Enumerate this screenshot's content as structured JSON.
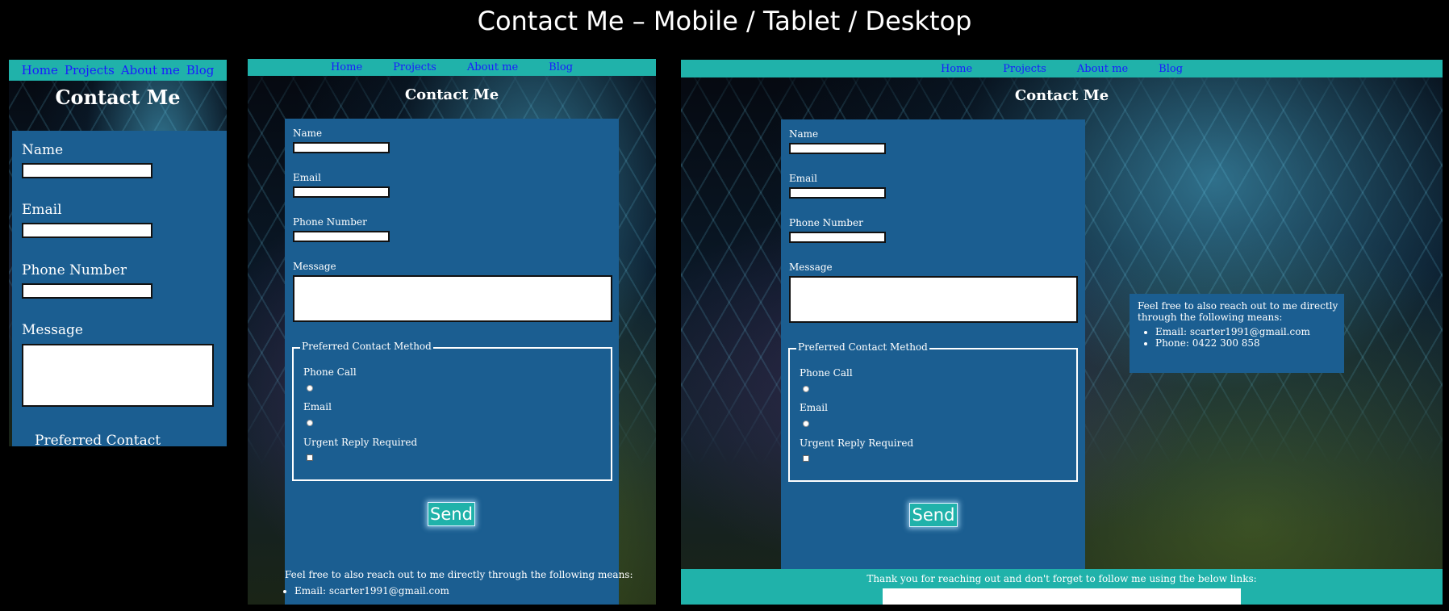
{
  "slide_title": "Contact Me – Mobile / Tablet / Desktop",
  "nav": {
    "home": "Home",
    "projects": "Projects",
    "about": "About me",
    "blog": "Blog"
  },
  "page_title": "Contact Me",
  "form": {
    "name_label": "Name",
    "email_label": "Email",
    "phone_label": "Phone Number",
    "message_label": "Message",
    "fieldset_legend": "Preferred Contact Method",
    "mobile_legend_partial": "Preferred Contact",
    "option_phone": "Phone Call",
    "option_email": "Email",
    "option_urgent": "Urgent Reply Required",
    "send_label": "Send"
  },
  "contact_info": {
    "intro_full": "Feel free to also reach out to me directly through the following means:",
    "intro_line1": "Feel free to also reach out to me directly",
    "intro_line2": "through the following means:",
    "email": "Email: scarter1991@gmail.com",
    "phone": "Phone: 0422 300 858"
  },
  "footer": {
    "text": "Thank you for reaching out and don't forget to follow me using the below links:"
  },
  "colors": {
    "nav": "#20b2aa",
    "panel": "#1b5e91",
    "link": "#1a1aff",
    "background": "#000000"
  }
}
